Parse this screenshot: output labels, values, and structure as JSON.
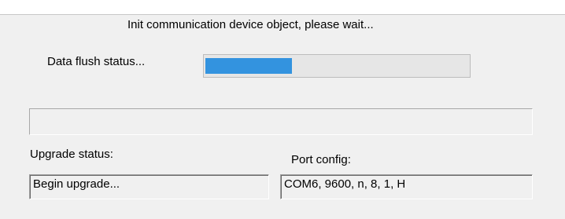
{
  "dialog": {
    "header_text": "Init communication device object, please wait...",
    "flush_label": "Data flush status...",
    "flush_progress": 0.33,
    "accent_color": "#3393df",
    "upgrade_label": "Upgrade status:",
    "upgrade_value": "Begin upgrade...",
    "port_label": "Port config:",
    "port_value": "COM6, 9600, n, 8, 1, H",
    "wide_field_value": ""
  }
}
